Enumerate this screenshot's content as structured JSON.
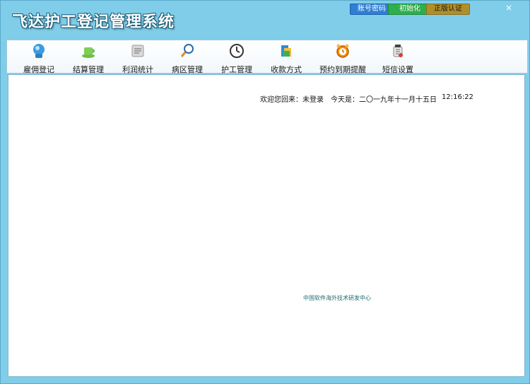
{
  "window": {
    "title": "飞达护工登记管理系统"
  },
  "top_buttons": {
    "account": "账号密码",
    "init": "初始化",
    "auth": "正版认证"
  },
  "close": "×",
  "toolbar": {
    "items": [
      {
        "label": "雇佣登记",
        "icon": "hire-registration-icon"
      },
      {
        "label": "结算管理",
        "icon": "settlement-icon"
      },
      {
        "label": "利润统计",
        "icon": "profit-stats-icon"
      },
      {
        "label": "病区管理",
        "icon": "ward-management-icon"
      },
      {
        "label": "护工管理",
        "icon": "caregiver-management-icon"
      },
      {
        "label": "收款方式",
        "icon": "payment-method-icon"
      },
      {
        "label": "预约到期提醒",
        "icon": "reminder-icon"
      },
      {
        "label": "短信设置",
        "icon": "sms-settings-icon"
      }
    ]
  },
  "status": {
    "welcome": "欢迎您回来：未登录",
    "date": "今天是：二〇一九年十一月十五日",
    "time": "12:16:22"
  },
  "footer": "中国软件海外技术研发中心"
}
